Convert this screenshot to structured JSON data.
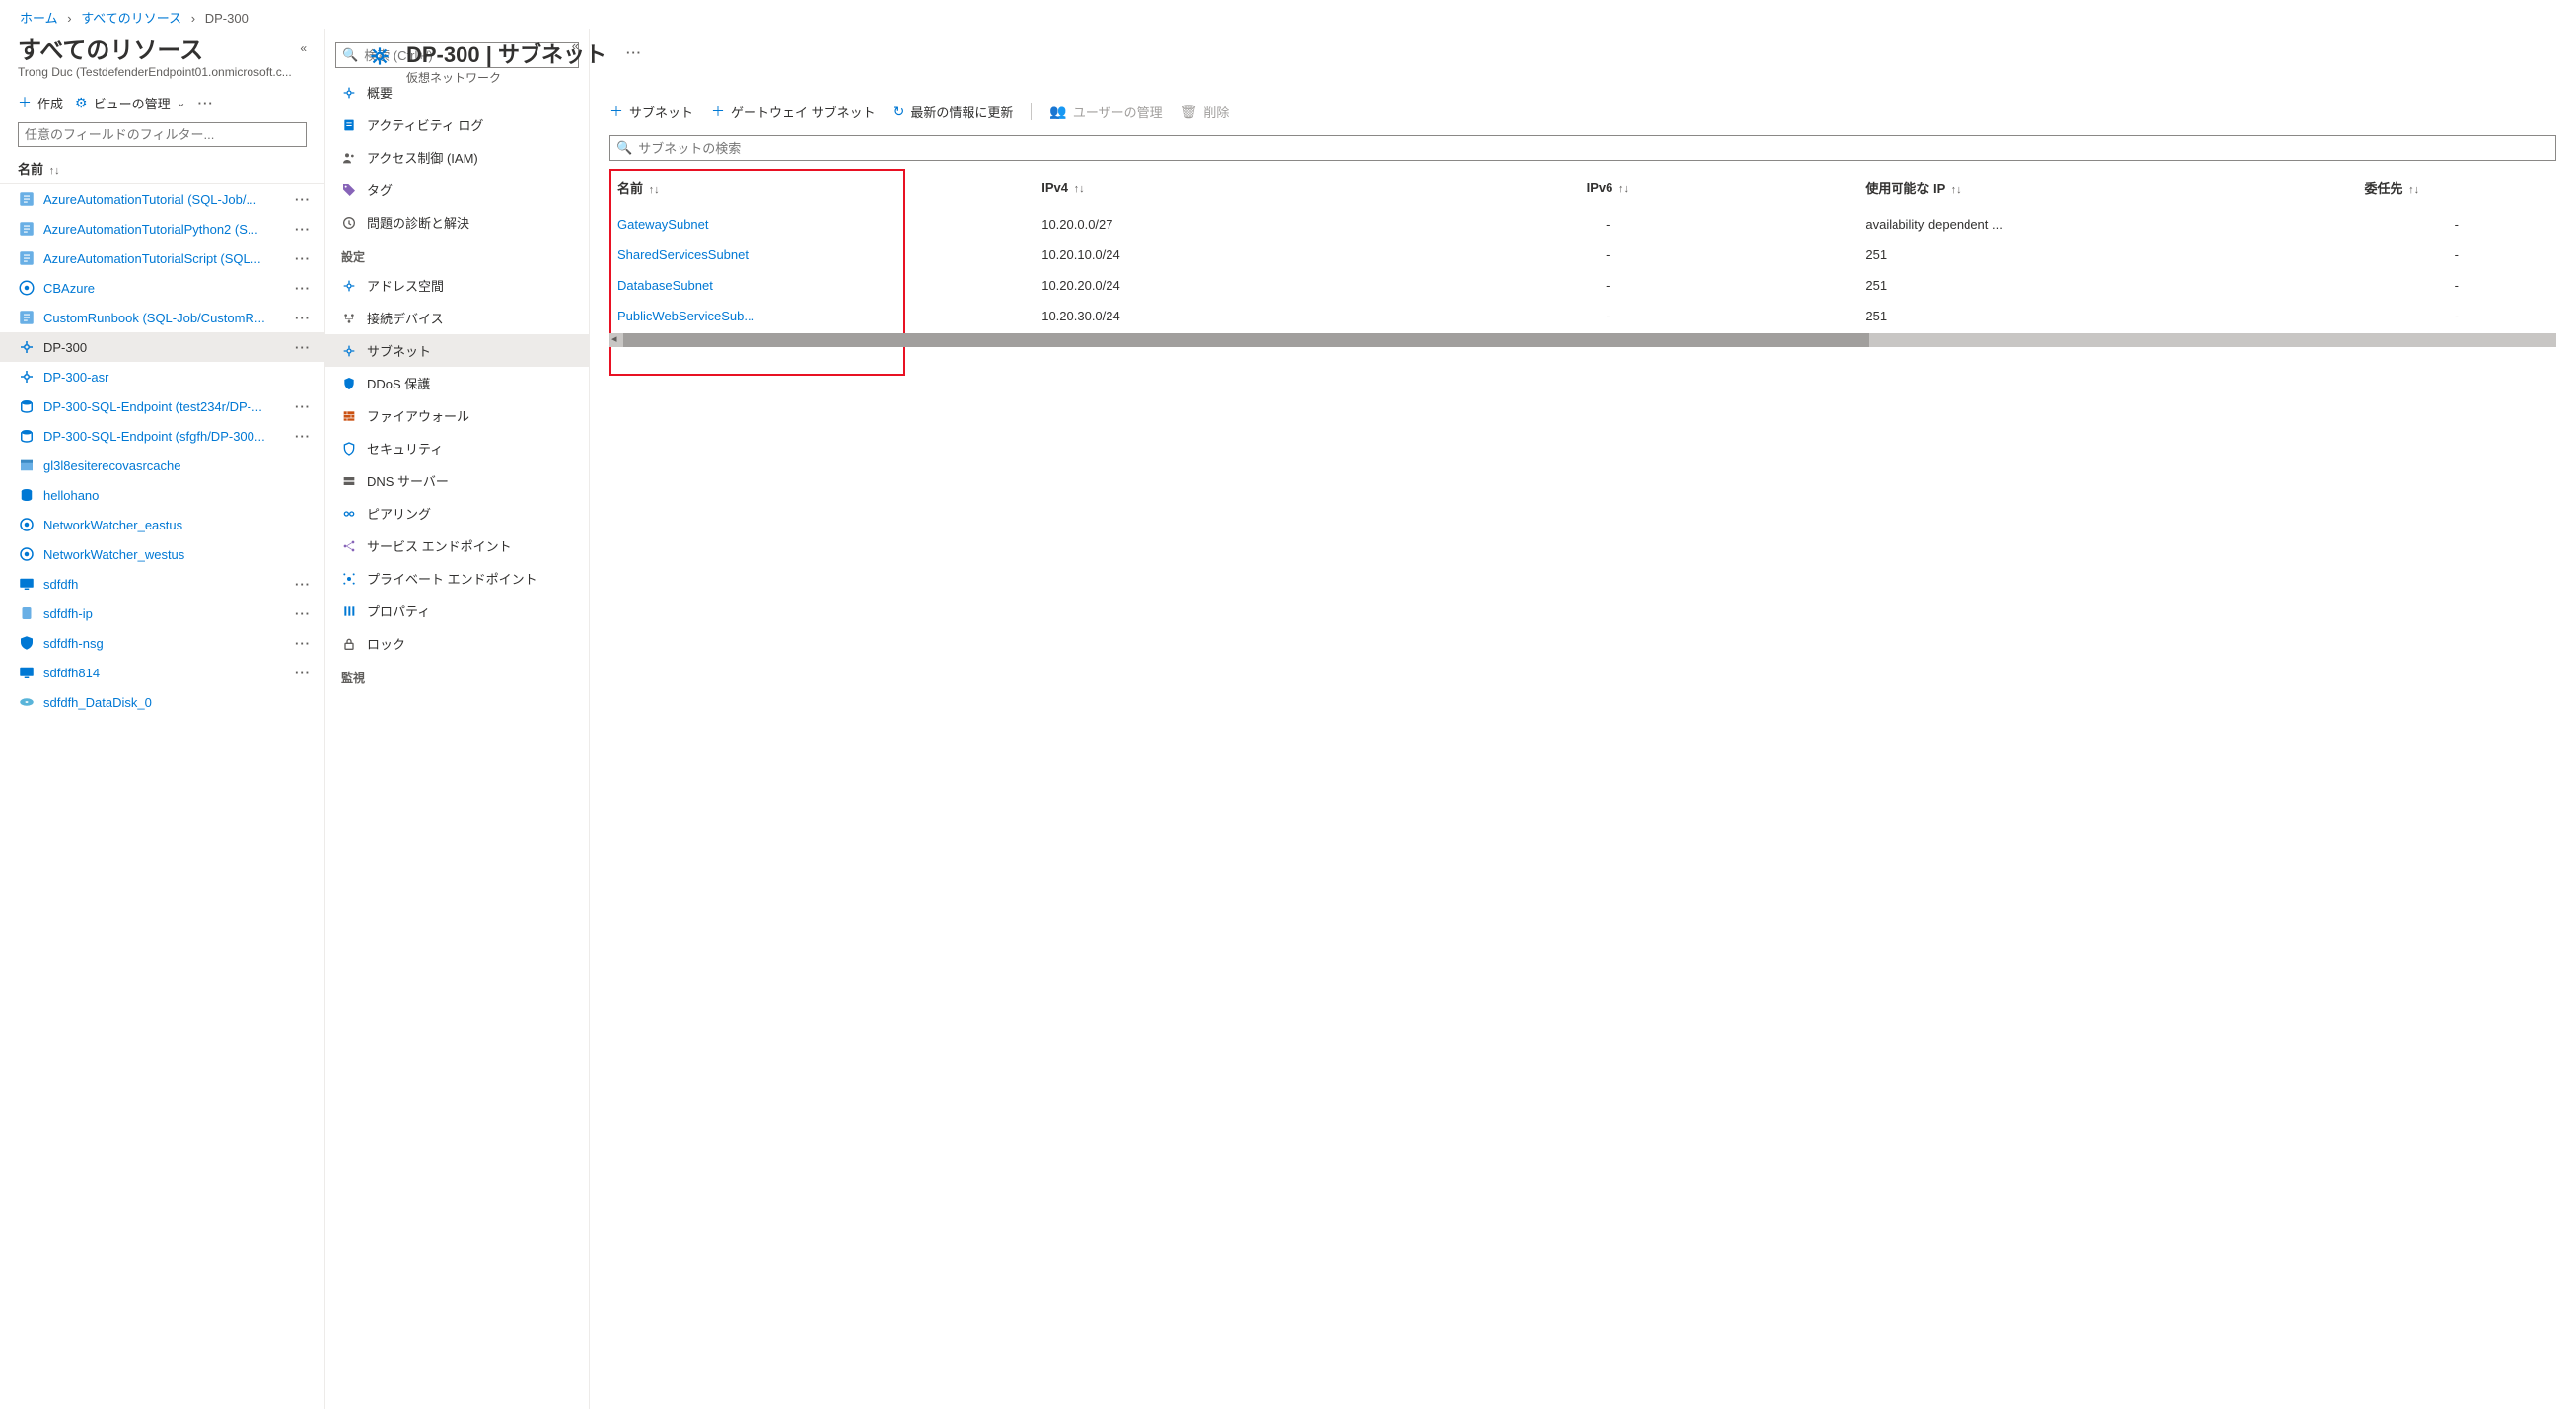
{
  "breadcrumb": {
    "home": "ホーム",
    "all": "すべてのリソース",
    "current": "DP-300"
  },
  "resources": {
    "title": "すべてのリソース",
    "subtitle": "Trong Duc (TestdefenderEndpoint01.onmicrosoft.c...",
    "toolbar": {
      "create": "作成",
      "manage_view": "ビューの管理"
    },
    "filter_placeholder": "任意のフィールドのフィルター...",
    "col_name": "名前",
    "items": [
      {
        "label": "AzureAutomationTutorial (SQL-Job/...",
        "icon": "runbook",
        "more": true
      },
      {
        "label": "AzureAutomationTutorialPython2 (S...",
        "icon": "runbook",
        "more": true
      },
      {
        "label": "AzureAutomationTutorialScript (SQL...",
        "icon": "runbook",
        "more": true
      },
      {
        "label": "CBAzure",
        "icon": "automation",
        "more": true
      },
      {
        "label": "CustomRunbook (SQL-Job/CustomR...",
        "icon": "runbook",
        "more": true
      },
      {
        "label": "DP-300",
        "icon": "vnet",
        "more": true,
        "selected": true
      },
      {
        "label": "DP-300-asr",
        "icon": "vnet",
        "more": false
      },
      {
        "label": "DP-300-SQL-Endpoint (test234r/DP-...",
        "icon": "sqlpe",
        "more": true
      },
      {
        "label": "DP-300-SQL-Endpoint (sfgfh/DP-300...",
        "icon": "sqlpe",
        "more": true
      },
      {
        "label": "gl3l8esiterecovasrcache",
        "icon": "storage",
        "more": false
      },
      {
        "label": "hellohano",
        "icon": "sql",
        "more": false
      },
      {
        "label": "NetworkWatcher_eastus",
        "icon": "watcher",
        "more": false
      },
      {
        "label": "NetworkWatcher_westus",
        "icon": "watcher",
        "more": false
      },
      {
        "label": "sdfdfh",
        "icon": "vm",
        "more": true
      },
      {
        "label": "sdfdfh-ip",
        "icon": "ip",
        "more": true
      },
      {
        "label": "sdfdfh-nsg",
        "icon": "nsg",
        "more": true
      },
      {
        "label": "sdfdfh814",
        "icon": "vm",
        "more": true
      },
      {
        "label": "sdfdfh_DataDisk_0",
        "icon": "disk",
        "more": false
      }
    ]
  },
  "blade": {
    "title": "DP-300 | サブネット",
    "subtitle": "仮想ネットワーク",
    "search_placeholder": "検索 (Ctrl+/)",
    "nav": [
      {
        "label": "概要",
        "icon": "vnet"
      },
      {
        "label": "アクティビティ ログ",
        "icon": "log"
      },
      {
        "label": "アクセス制御 (IAM)",
        "icon": "iam"
      },
      {
        "label": "タグ",
        "icon": "tag"
      },
      {
        "label": "問題の診断と解決",
        "icon": "diag"
      }
    ],
    "section_settings": "設定",
    "nav_settings": [
      {
        "label": "アドレス空間",
        "icon": "vnet"
      },
      {
        "label": "接続デバイス",
        "icon": "devices"
      },
      {
        "label": "サブネット",
        "icon": "vnet",
        "selected": true
      },
      {
        "label": "DDoS 保護",
        "icon": "shield"
      },
      {
        "label": "ファイアウォール",
        "icon": "firewall"
      },
      {
        "label": "セキュリティ",
        "icon": "security"
      },
      {
        "label": "DNS サーバー",
        "icon": "dns"
      },
      {
        "label": "ピアリング",
        "icon": "peering"
      },
      {
        "label": "サービス エンドポイント",
        "icon": "endpoint"
      },
      {
        "label": "プライベート エンドポイント",
        "icon": "pendpoint"
      },
      {
        "label": "プロパティ",
        "icon": "props"
      },
      {
        "label": "ロック",
        "icon": "lock"
      }
    ],
    "section_monitor": "監視"
  },
  "content": {
    "cmd": {
      "add_subnet": "サブネット",
      "add_gateway": "ゲートウェイ サブネット",
      "refresh": "最新の情報に更新",
      "manage_users": "ユーザーの管理",
      "delete": "削除"
    },
    "search_placeholder": "サブネットの検索",
    "columns": {
      "name": "名前",
      "ipv4": "IPv4",
      "ipv6": "IPv6",
      "available": "使用可能な IP",
      "delegation": "委任先"
    },
    "rows": [
      {
        "name": "GatewaySubnet",
        "ipv4": "10.20.0.0/27",
        "ipv6": "-",
        "available": "availability dependent ...",
        "delegation": "-"
      },
      {
        "name": "SharedServicesSubnet",
        "ipv4": "10.20.10.0/24",
        "ipv6": "-",
        "available": "251",
        "delegation": "-"
      },
      {
        "name": "DatabaseSubnet",
        "ipv4": "10.20.20.0/24",
        "ipv6": "-",
        "available": "251",
        "delegation": "-"
      },
      {
        "name": "PublicWebServiceSub...",
        "ipv4": "10.20.30.0/24",
        "ipv6": "-",
        "available": "251",
        "delegation": "-"
      }
    ]
  },
  "glyphs": {
    "plus": "＋",
    "gear": "⚙",
    "chevd": "⌄",
    "refresh": "↻",
    "people": "👥",
    "trash": "🗑",
    "search": "🔍",
    "sort": "↑↓",
    "dots": "···",
    "chev_left": "«"
  }
}
